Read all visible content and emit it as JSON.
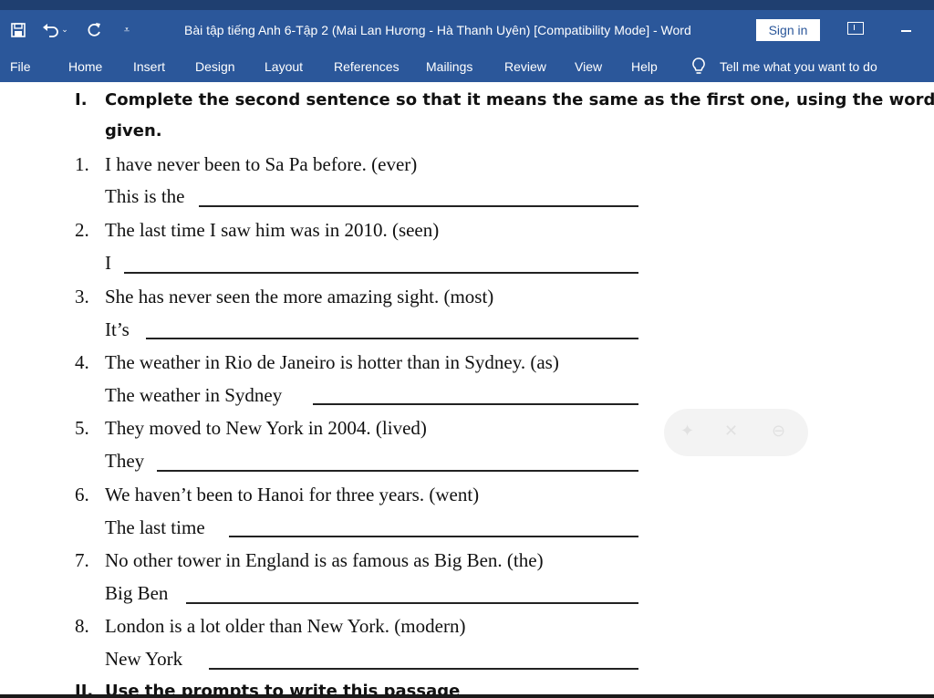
{
  "window": {
    "title": "Bài tập tiếng Anh 6-Tập 2 (Mai Lan Hương - Hà Thanh Uyên) [Compatibility Mode]  -  Word",
    "sign_in_label": "Sign in"
  },
  "qat": {
    "save_icon": "save-icon",
    "undo_icon": "undo-icon",
    "redo_icon": "redo-icon",
    "customize_icon": "customize-qat-icon"
  },
  "menu": {
    "tabs": [
      "File",
      "Home",
      "Insert",
      "Design",
      "Layout",
      "References",
      "Mailings",
      "Review",
      "View",
      "Help"
    ],
    "tell_me": "Tell me what you want to do"
  },
  "document": {
    "section1": {
      "number": "I.",
      "line1": "Complete the second sentence so that it means the same as the first one, using the word",
      "line2": "given."
    },
    "questions": [
      {
        "num": "1.",
        "text": "I have never been to Sa Pa before. (ever)",
        "answer_start": "This is the"
      },
      {
        "num": "2.",
        "text": "The last time I saw him was in 2010. (seen)",
        "answer_start": "I"
      },
      {
        "num": "3.",
        "text": "She has never seen the more amazing sight. (most)",
        "answer_start": "It’s"
      },
      {
        "num": "4.",
        "text": "The weather in Rio de Janeiro is hotter than in Sydney. (as)",
        "answer_start": "The weather in Sydney"
      },
      {
        "num": "5.",
        "text": "They moved to New York in 2004. (lived)",
        "answer_start": "They"
      },
      {
        "num": "6.",
        "text": "We haven’t been to Hanoi for three years. (went)",
        "answer_start": "The last time"
      },
      {
        "num": "7.",
        "text": "No other tower in England is as famous as Big Ben. (the)",
        "answer_start": "Big Ben"
      },
      {
        "num": "8.",
        "text": "London is a lot older than New York. (modern)",
        "answer_start": "New York"
      }
    ],
    "section2": {
      "number": "II.",
      "text": "Use the prompts to write this passage"
    }
  }
}
